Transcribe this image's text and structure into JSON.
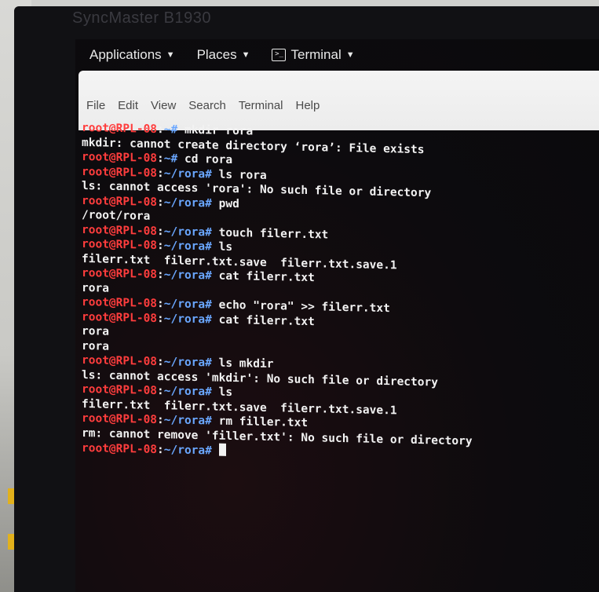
{
  "monitor": {
    "brand": "SyncMaster B1930"
  },
  "panel": {
    "applications": "Applications",
    "places": "Places",
    "terminal": "Terminal",
    "terminal_icon": "terminal-icon",
    "caret_icon": "chevron-down-icon"
  },
  "menubar": [
    "File",
    "Edit",
    "View",
    "Search",
    "Terminal",
    "Help"
  ],
  "prompt_user": "root@RPL-08",
  "colors": {
    "prompt_user": "#ff3d3d",
    "prompt_path": "#6aa7ff",
    "text": "#f2f2f2"
  },
  "lines": [
    {
      "kind": "prompt",
      "path": "~",
      "cmd": "mkdir rora"
    },
    {
      "kind": "out",
      "text": "mkdir: cannot create directory ‘rora’: File exists"
    },
    {
      "kind": "prompt",
      "path": "~",
      "cmd": "cd rora"
    },
    {
      "kind": "prompt",
      "path": "~/rora",
      "cmd": "ls rora"
    },
    {
      "kind": "out",
      "text": "ls: cannot access 'rora': No such file or directory"
    },
    {
      "kind": "prompt",
      "path": "~/rora",
      "cmd": "pwd"
    },
    {
      "kind": "out",
      "text": "/root/rora"
    },
    {
      "kind": "prompt",
      "path": "~/rora",
      "cmd": "touch filerr.txt"
    },
    {
      "kind": "prompt",
      "path": "~/rora",
      "cmd": "ls"
    },
    {
      "kind": "out",
      "text": "filerr.txt  filerr.txt.save  filerr.txt.save.1"
    },
    {
      "kind": "prompt",
      "path": "~/rora",
      "cmd": "cat filerr.txt"
    },
    {
      "kind": "out",
      "text": "rora"
    },
    {
      "kind": "prompt",
      "path": "~/rora",
      "cmd": "echo \"rora\" >> filerr.txt"
    },
    {
      "kind": "prompt",
      "path": "~/rora",
      "cmd": "cat filerr.txt"
    },
    {
      "kind": "out",
      "text": "rora"
    },
    {
      "kind": "out",
      "text": "rora"
    },
    {
      "kind": "prompt",
      "path": "~/rora",
      "cmd": "ls mkdir"
    },
    {
      "kind": "out",
      "text": "ls: cannot access 'mkdir': No such file or directory"
    },
    {
      "kind": "prompt",
      "path": "~/rora",
      "cmd": "ls"
    },
    {
      "kind": "out",
      "text": "filerr.txt  filerr.txt.save  filerr.txt.save.1"
    },
    {
      "kind": "prompt",
      "path": "~/rora",
      "cmd": "rm filler.txt"
    },
    {
      "kind": "out",
      "text": "rm: cannot remove 'filler.txt': No such file or directory"
    },
    {
      "kind": "prompt",
      "path": "~/rora",
      "cmd": "",
      "cursor": true
    }
  ]
}
